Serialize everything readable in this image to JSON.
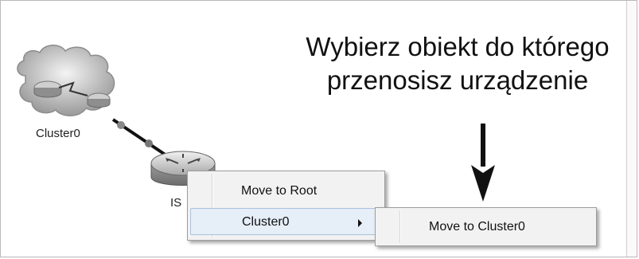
{
  "annotation": {
    "line1": "Wybierz obiekt do którego",
    "line2": "przenosisz urządzenie"
  },
  "topology": {
    "cluster_label": "Cluster0",
    "device_label": "IS"
  },
  "context_menu": {
    "items": [
      {
        "label": "Move to Root"
      },
      {
        "label": "Cluster0",
        "has_submenu": true
      }
    ]
  },
  "submenu": {
    "items": [
      {
        "label": "Move to Cluster0"
      }
    ]
  },
  "icons": {
    "cluster": "cloud-cluster-icon",
    "router": "router-icon",
    "arrow": "down-arrow-icon"
  }
}
